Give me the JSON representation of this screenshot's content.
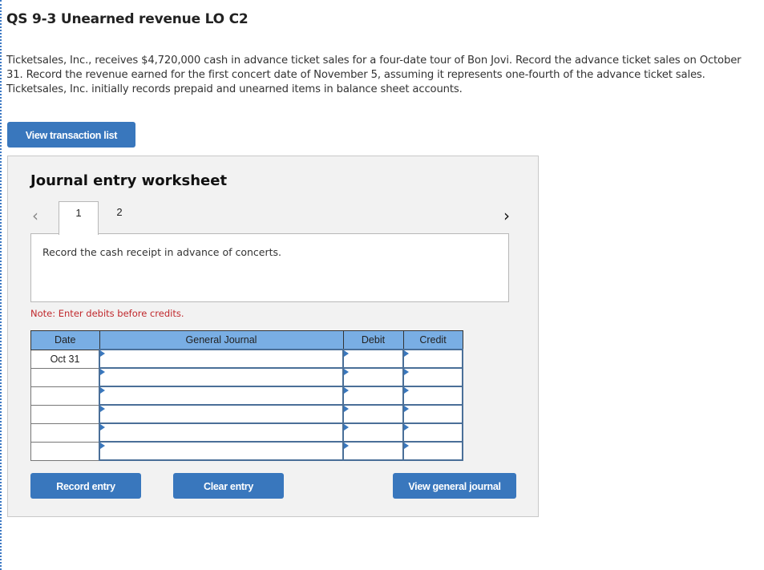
{
  "problem": {
    "title": "QS 9-3 Unearned revenue LO C2",
    "text": "Ticketsales, Inc., receives $4,720,000 cash in advance ticket sales for a four-date tour of Bon Jovi. Record the advance ticket sales on October 31. Record the revenue earned for the first concert date of November 5, assuming it represents one-fourth of the advance ticket sales. Ticketsales, Inc. initially records prepaid and unearned items in balance sheet accounts."
  },
  "buttons": {
    "view_transaction_list": "View transaction list",
    "record_entry": "Record entry",
    "clear_entry": "Clear entry",
    "view_general_journal": "View general journal"
  },
  "worksheet": {
    "title": "Journal entry worksheet",
    "prev_icon": "‹",
    "next_icon": "›",
    "tabs": [
      {
        "label": "1",
        "active": true
      },
      {
        "label": "2",
        "active": false
      }
    ],
    "instruction": "Record the cash receipt in advance of concerts.",
    "note": "Note: Enter debits before credits."
  },
  "journal": {
    "headers": [
      "Date",
      "General Journal",
      "Debit",
      "Credit"
    ],
    "rows": [
      {
        "date": "Oct 31",
        "account": "",
        "debit": "",
        "credit": ""
      },
      {
        "date": "",
        "account": "",
        "debit": "",
        "credit": ""
      },
      {
        "date": "",
        "account": "",
        "debit": "",
        "credit": ""
      },
      {
        "date": "",
        "account": "",
        "debit": "",
        "credit": ""
      },
      {
        "date": "",
        "account": "",
        "debit": "",
        "credit": ""
      },
      {
        "date": "",
        "account": "",
        "debit": "",
        "credit": ""
      }
    ]
  }
}
